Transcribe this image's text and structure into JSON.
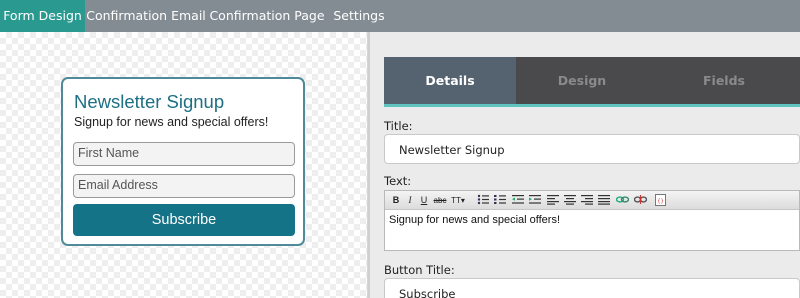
{
  "topnav": {
    "tabs": [
      {
        "label": "Form Design",
        "active": true
      },
      {
        "label": "Confirmation Email",
        "active": false
      },
      {
        "label": "Confirmation Page",
        "active": false
      },
      {
        "label": "Settings",
        "active": false
      }
    ]
  },
  "preview": {
    "title": "Newsletter Signup",
    "subtitle": "Signup for news and special offers!",
    "first_name_placeholder": "First Name",
    "email_placeholder": "Email Address",
    "button": "Subscribe"
  },
  "panel": {
    "tabs": [
      {
        "label": "Details",
        "active": true
      },
      {
        "label": "Design",
        "active": false
      },
      {
        "label": "Fields",
        "active": false
      }
    ],
    "title_label": "Title:",
    "title_value": "Newsletter Signup",
    "text_label": "Text:",
    "text_value": "Signup for news and special offers!",
    "button_title_label": "Button Title:",
    "button_title_value": "Subscribe",
    "toolbar": [
      "bold-icon",
      "italic-icon",
      "underline-icon",
      "strikethrough-icon",
      "font-size-icon",
      "bullet-list-icon",
      "numbered-list-icon",
      "outdent-icon",
      "indent-icon",
      "align-left-icon",
      "align-center-icon",
      "align-right-icon",
      "justify-icon",
      "link-icon",
      "unlink-icon",
      "source-code-icon"
    ]
  },
  "colors": {
    "nav_bg": "#838b93",
    "nav_active": "#2a9a90",
    "preview_accent": "#157387",
    "panel_tab_active": "#556370",
    "tab_underline": "#5fc3c0"
  }
}
